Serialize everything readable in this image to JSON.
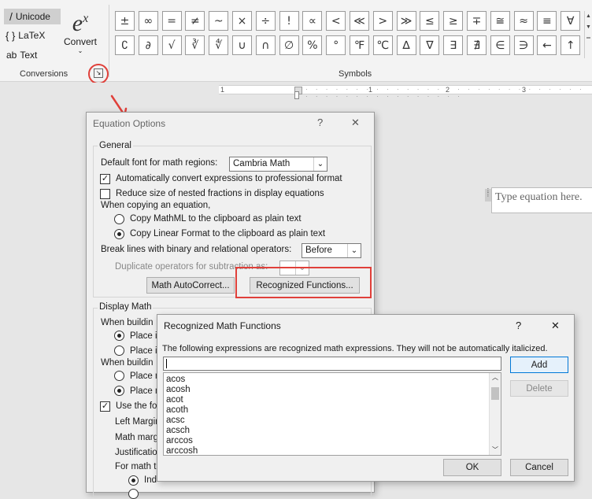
{
  "ribbon": {
    "conversions": {
      "items": [
        {
          "icon": "slash",
          "label": "Unicode"
        },
        {
          "icon": "{}",
          "label": "LaTeX"
        },
        {
          "icon": "ab",
          "label": "Text"
        }
      ],
      "convert_label": "Convert",
      "convert_glyph": "e",
      "convert_sup": "x",
      "group_label": "Conversions"
    },
    "symbols": {
      "row1": [
        "±",
        "∞",
        "=",
        "≠",
        "~",
        "×",
        "÷",
        "!",
        "∝",
        "<",
        "≪",
        ">",
        "≫",
        "≤",
        "≥",
        "∓",
        "≅",
        "≈",
        "≡",
        "∀"
      ],
      "row2": [
        "∁",
        "∂",
        "√",
        "∛",
        "∜",
        "∪",
        "∩",
        "∅",
        "%",
        "°",
        "℉",
        "℃",
        "∆",
        "∇",
        "∃",
        "∄",
        "∈",
        "∋",
        "←",
        "↑"
      ],
      "group_label": "Symbols"
    }
  },
  "ruler": {
    "marks": [
      "1",
      "1",
      "2",
      "3"
    ]
  },
  "equation_placeholder": "Type equation here.",
  "equation_options": {
    "title": "Equation Options",
    "help": "?",
    "close": "✕",
    "general_label": "General",
    "default_font_label": "Default font for math regions:",
    "default_font_value": "Cambria Math",
    "auto_convert_label": "Automatically convert expressions to professional format",
    "auto_convert_checked": true,
    "reduce_size_label": "Reduce size of nested fractions in display equations",
    "reduce_size_checked": false,
    "copying_label": "When copying an equation,",
    "copy_mathml_label": "Copy MathML to the clipboard as plain text",
    "copy_linear_label": "Copy Linear Format to the clipboard as plain text",
    "break_lines_label": "Break lines with binary and relational operators:",
    "break_lines_value": "Before",
    "duplicate_label": "Duplicate operators for subtraction as:",
    "duplicate_value": "--",
    "math_autocorrect_btn": "Math AutoCorrect...",
    "recognized_functions_btn": "Recognized Functions...",
    "display_math_label": "Display Math",
    "when_building_1": "When buildin",
    "place_in_1": "Place in",
    "place_in_2": "Place in",
    "when_building_2": "When buildin",
    "place_n_1": "Place n",
    "place_n_2": "Place n",
    "use_the_label": "Use the fo",
    "left_margin_label": "Left Margin",
    "math_margin_label": "Math marg",
    "justification_label": "Justificatio",
    "for_math_label": "For math t",
    "indent_label": "Ind"
  },
  "recognized": {
    "title": "Recognized Math Functions",
    "help": "?",
    "close": "✕",
    "description": "The following expressions are recognized math expressions. They will not be automatically italicized.",
    "input_value": "",
    "add_btn": "Add",
    "delete_btn": "Delete",
    "ok_btn": "OK",
    "cancel_btn": "Cancel",
    "functions": [
      "acos",
      "acosh",
      "acot",
      "acoth",
      "acsc",
      "acsch",
      "arccos",
      "arccosh"
    ]
  },
  "colors": {
    "annotation_red": "#e0403a",
    "accent_blue": "#0078d7"
  }
}
